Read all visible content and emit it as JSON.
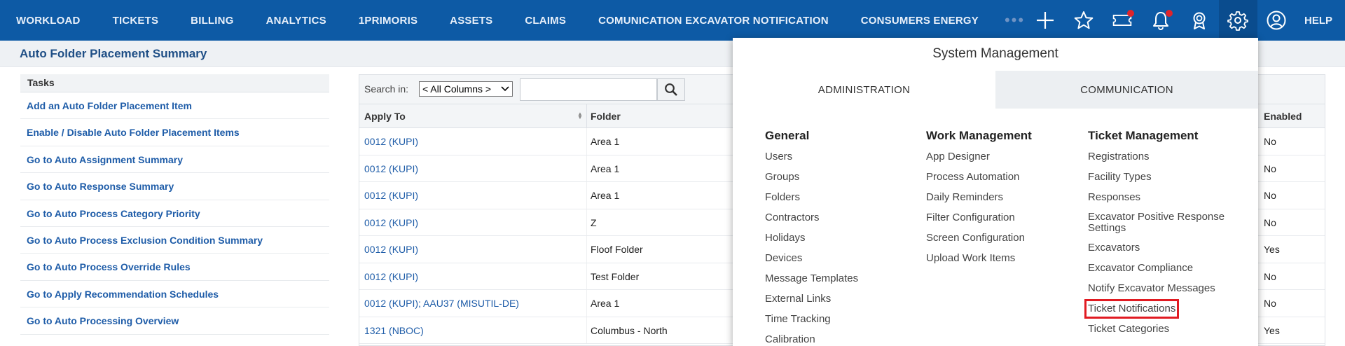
{
  "topnav": {
    "items": [
      "WORKLOAD",
      "TICKETS",
      "BILLING",
      "ANALYTICS",
      "1PRIMORIS",
      "ASSETS",
      "CLAIMS",
      "COMUNICATION EXCAVATOR NOTIFICATION",
      "CONSUMERS ENERGY"
    ],
    "more": "•••",
    "help": "HELP",
    "icons": [
      "plus-icon",
      "star-icon",
      "ticket-icon",
      "bell-icon",
      "award-icon",
      "gear-icon",
      "user-icon"
    ]
  },
  "page": {
    "title": "Auto Folder Placement Summary"
  },
  "tasks": {
    "header": "Tasks",
    "items": [
      "Add an Auto Folder Placement Item",
      "Enable / Disable Auto Folder Placement Items",
      "Go to Auto Assignment Summary",
      "Go to Auto Response Summary",
      "Go to Auto Process Category Priority",
      "Go to Auto Process Exclusion Condition Summary",
      "Go to Auto Process Override Rules",
      "Go to Apply Recommendation Schedules",
      "Go to Auto Processing Overview"
    ]
  },
  "grid": {
    "search_label": "Search in:",
    "search_select": "< All Columns >",
    "search_value": "",
    "columns": {
      "apply_to": "Apply To",
      "folder": "Folder",
      "enabled": "Enabled"
    },
    "rows": [
      {
        "apply_to": "0012 (KUPI)",
        "folder": "Area 1",
        "enabled": "No"
      },
      {
        "apply_to": "0012 (KUPI)",
        "folder": "Area 1",
        "enabled": "No"
      },
      {
        "apply_to": "0012 (KUPI)",
        "folder": "Area 1",
        "enabled": "No"
      },
      {
        "apply_to": "0012 (KUPI)",
        "folder": "Z",
        "enabled": "No"
      },
      {
        "apply_to": "0012 (KUPI)",
        "folder": "Floof Folder",
        "enabled": "Yes"
      },
      {
        "apply_to": "0012 (KUPI)",
        "folder": "Test Folder",
        "enabled": "No"
      },
      {
        "apply_to": "0012 (KUPI); AAU37 (MISUTIL-DE)",
        "folder": "Area 1",
        "enabled": "No"
      },
      {
        "apply_to": "1321 (NBOC)",
        "folder": "Columbus - North",
        "enabled": "Yes"
      }
    ]
  },
  "sysmenu": {
    "title": "System Management",
    "tabs": [
      "ADMINISTRATION",
      "COMMUNICATION"
    ],
    "general": {
      "heading": "General",
      "items": [
        "Users",
        "Groups",
        "Folders",
        "Contractors",
        "Holidays",
        "Devices",
        "Message Templates",
        "External Links",
        "Time Tracking",
        "Calibration"
      ]
    },
    "work": {
      "heading": "Work Management",
      "items": [
        "App Designer",
        "Process Automation",
        "Daily Reminders",
        "Filter Configuration",
        "Screen Configuration",
        "Upload Work Items"
      ]
    },
    "ticket": {
      "heading": "Ticket Management",
      "items": [
        "Registrations",
        "Facility Types",
        "Responses",
        "Excavator Positive Response Settings",
        "Excavators",
        "Excavator Compliance",
        "Notify Excavator Messages",
        "Ticket Notifications",
        "Ticket Categories"
      ]
    }
  },
  "colors": {
    "nav_bg": "#0d5aa5",
    "link": "#1e5ca8",
    "highlight_box": "#e11b22"
  }
}
